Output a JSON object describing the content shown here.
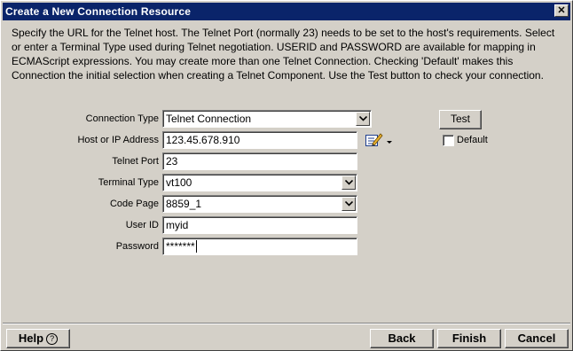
{
  "window": {
    "title": "Create a New Connection Resource",
    "close_glyph": "✕"
  },
  "description": "Specify the URL for the Telnet host.  The Telnet Port (normally 23) needs to be set to the host's requirements.  Select or enter a Terminal Type used during Telnet negotiation.  USERID and PASSWORD are available for mapping in ECMAScript expressions.  You may create more than one Telnet Connection.  Checking 'Default' makes this Connection the initial selection when creating a Telnet Component.  Use the Test button to check your connection.",
  "form": {
    "connection_type": {
      "label": "Connection Type",
      "value": "Telnet Connection"
    },
    "host": {
      "label": "Host or IP Address",
      "value": "123.45.678.910"
    },
    "telnet_port": {
      "label": "Telnet Port",
      "value": "23"
    },
    "terminal_type": {
      "label": "Terminal Type",
      "value": "vt100"
    },
    "code_page": {
      "label": "Code Page",
      "value": "8859_1"
    },
    "user_id": {
      "label": "User ID",
      "value": "myid"
    },
    "password": {
      "label": "Password",
      "value": "*******"
    },
    "default_checkbox": {
      "label": "Default",
      "checked": false
    },
    "test_button": "Test",
    "edit_icon": "edit-pencil-icon"
  },
  "footer": {
    "help_label": "Help",
    "help_icon_glyph": "?",
    "back_label": "Back",
    "finish_label": "Finish",
    "cancel_label": "Cancel"
  },
  "colors": {
    "titlebar": "#0a246a",
    "dialog_face": "#d4d0c8"
  }
}
